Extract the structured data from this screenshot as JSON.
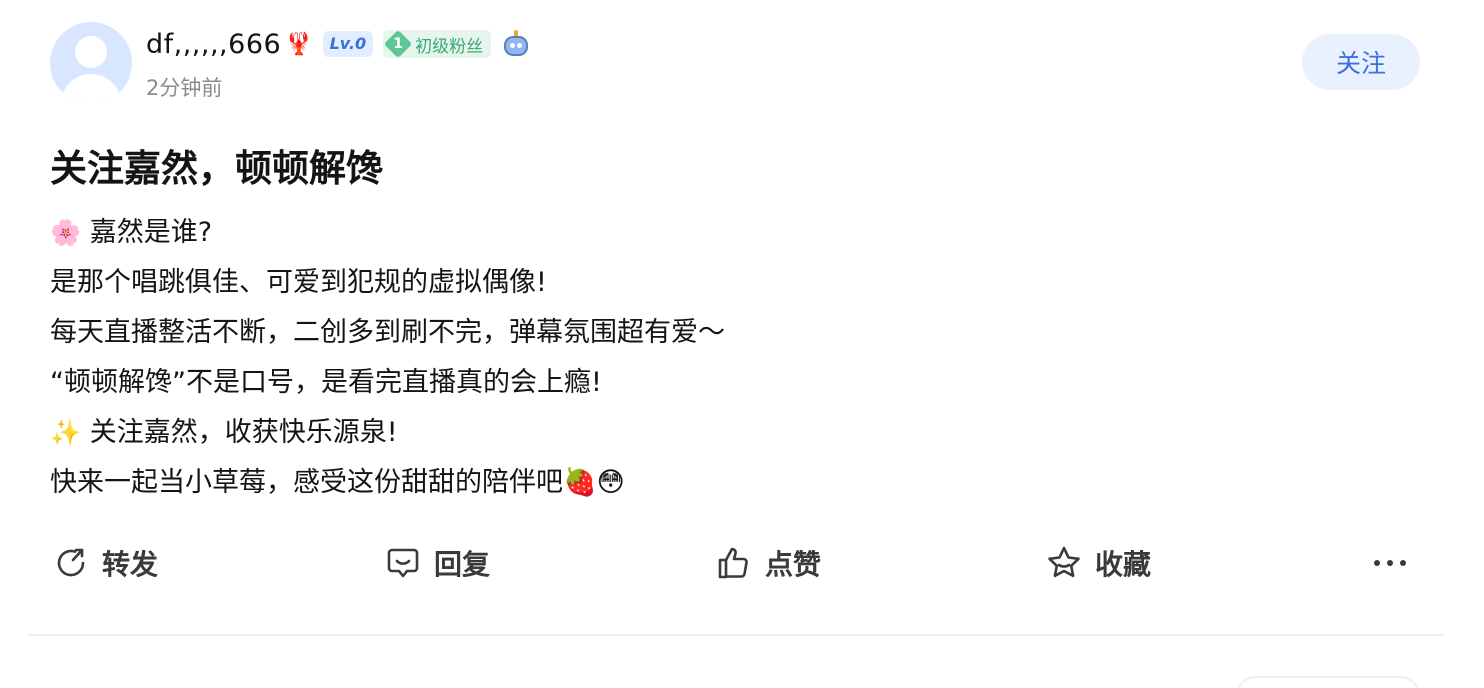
{
  "user": {
    "name": "df,,,,,,666",
    "name_emoji": "🦞",
    "level": "Lv.0",
    "fan_badge_level": "1",
    "fan_badge_label": "初级粉丝",
    "post_time": "2分钟前"
  },
  "follow_label": "关注",
  "post": {
    "title": "关注嘉然，顿顿解馋",
    "lines": [
      {
        "emoji": "🌸",
        "text": " 嘉然是谁?"
      },
      {
        "emoji": "",
        "text": "是那个唱跳俱佳、可爱到犯规的虚拟偶像!"
      },
      {
        "emoji": "",
        "text": "每天直播整活不断，二创多到刷不完，弹幕氛围超有爱～"
      },
      {
        "emoji": "",
        "text": "“顿顿解馋”不是口号，是看完直播真的会上瘾!"
      },
      {
        "emoji": "✨",
        "text": " 关注嘉然，收获快乐源泉!"
      },
      {
        "emoji": "",
        "text": "快来一起当小草莓，感受这份甜甜的陪伴吧🍓😳"
      }
    ]
  },
  "actions": {
    "repost": "转发",
    "reply": "回复",
    "like": "点赞",
    "favorite": "收藏"
  },
  "icons": [
    "avatar-placeholder",
    "lobster-emoji",
    "fan-gem-icon",
    "robot-icon",
    "repost-icon",
    "reply-icon",
    "like-icon",
    "favorite-icon",
    "more-icon"
  ],
  "colors": {
    "accent": "#3c6fe0",
    "follow_bg": "#eaf1fe",
    "fan_badge": "#3ba873",
    "text": "#141414",
    "muted": "#8c8c8c"
  }
}
